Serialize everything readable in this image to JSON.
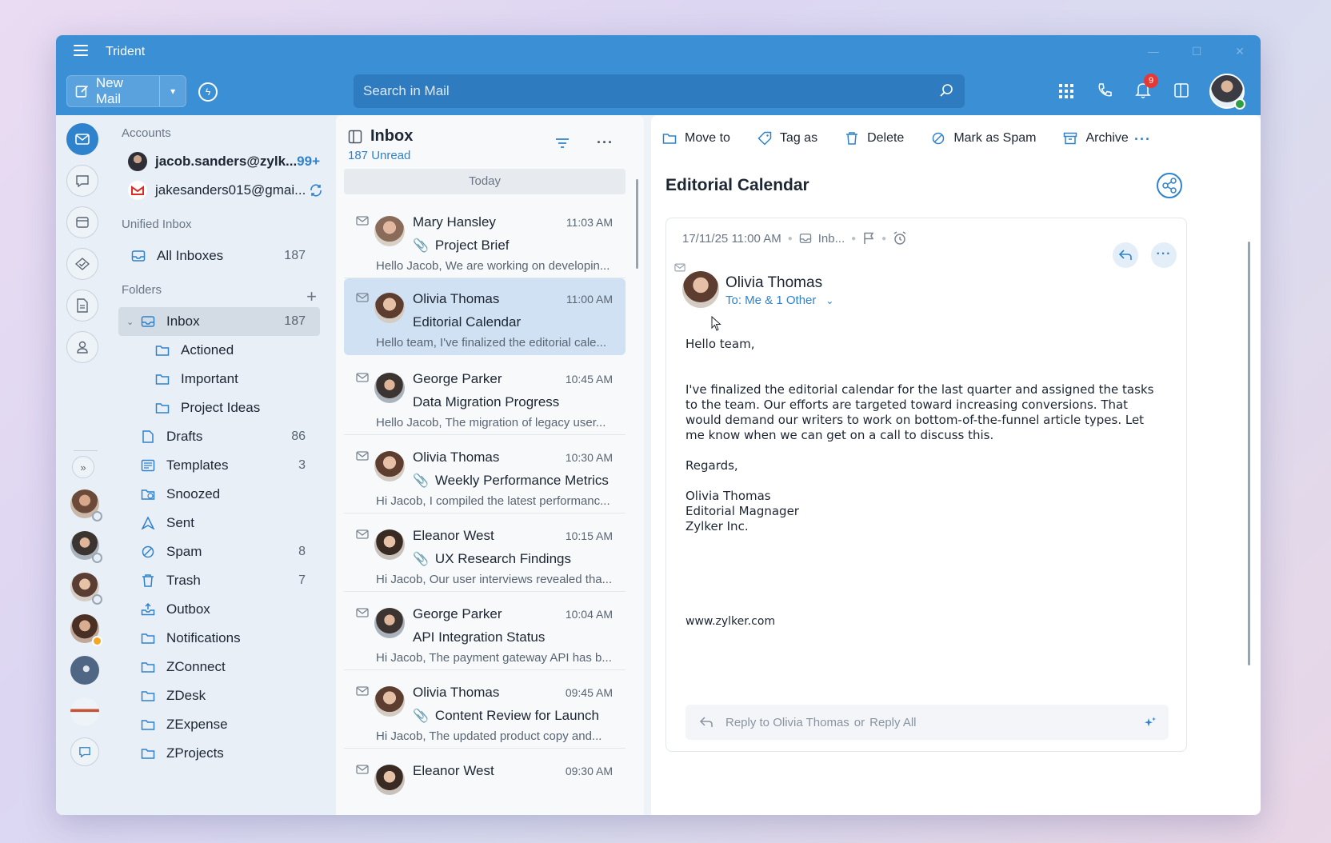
{
  "app": {
    "title": "Trident"
  },
  "header": {
    "new_mail_label": "New Mail",
    "search_placeholder": "Search in Mail",
    "notification_count": "9"
  },
  "rail": {
    "icons": [
      "mail-icon",
      "chat-icon",
      "calendar-icon",
      "tasks-icon",
      "notes-icon",
      "contacts-icon"
    ]
  },
  "folders": {
    "accounts_heading": "Accounts",
    "accounts": [
      {
        "label": "jacob.sanders@zylk...",
        "count": "99+"
      },
      {
        "label": "jakesanders015@gmai..."
      }
    ],
    "unified_heading": "Unified Inbox",
    "unified": [
      {
        "label": "All Inboxes",
        "count": "187"
      }
    ],
    "folders_heading": "Folders",
    "items": [
      {
        "label": "Inbox",
        "count": "187"
      },
      {
        "label": "Actioned"
      },
      {
        "label": "Important"
      },
      {
        "label": "Project Ideas"
      },
      {
        "label": "Drafts",
        "count": "86"
      },
      {
        "label": "Templates",
        "count": "3"
      },
      {
        "label": "Snoozed"
      },
      {
        "label": "Sent"
      },
      {
        "label": "Spam",
        "count": "8"
      },
      {
        "label": "Trash",
        "count": "7"
      },
      {
        "label": "Outbox"
      },
      {
        "label": "Notifications"
      },
      {
        "label": "ZConnect"
      },
      {
        "label": "ZDesk"
      },
      {
        "label": "ZExpense"
      },
      {
        "label": "ZProjects"
      }
    ]
  },
  "list": {
    "title": "Inbox",
    "unread": "187 Unread",
    "group": "Today",
    "messages": [
      {
        "from": "Mary Hansley",
        "time": "11:03 AM",
        "subject": "Project Brief",
        "preview": "Hello Jacob, We are working on developin..."
      },
      {
        "from": "Olivia Thomas",
        "time": "11:00 AM",
        "subject": "Editorial Calendar",
        "preview": "Hello team, I've finalized the editorial cale..."
      },
      {
        "from": "George Parker",
        "time": "10:45 AM",
        "subject": "Data Migration Progress",
        "preview": "Hello Jacob, The migration of legacy user..."
      },
      {
        "from": "Olivia Thomas",
        "time": "10:30 AM",
        "subject": "Weekly Performance Metrics",
        "preview": "Hi Jacob, I compiled the latest performanc..."
      },
      {
        "from": "Eleanor West",
        "time": "10:15 AM",
        "subject": "UX Research Findings",
        "preview": "Hi Jacob, Our user interviews revealed tha..."
      },
      {
        "from": "George Parker",
        "time": "10:04 AM",
        "subject": "API Integration Status",
        "preview": "Hi Jacob, The payment gateway API has b..."
      },
      {
        "from": "Olivia Thomas",
        "time": "09:45 AM",
        "subject": "Content Review for Launch",
        "preview": "Hi Jacob, The updated product copy and..."
      },
      {
        "from": "Eleanor West",
        "time": "09:30 AM"
      }
    ]
  },
  "reader": {
    "toolbar": {
      "move": "Move to",
      "tag": "Tag as",
      "delete": "Delete",
      "spam": "Mark as Spam",
      "archive": "Archive"
    },
    "subject": "Editorial Calendar",
    "date": "17/11/25 11:00 AM",
    "folder": "Inb...",
    "sender": "Olivia Thomas",
    "to": "To: Me & 1 Other",
    "greeting": "Hello team,",
    "paragraph": "I've finalized the editorial calendar for the last quarter and assigned the tasks to the team. Our efforts are targeted toward increasing conversions. That would demand our writers to work on bottom-of-the-funnel article types. Let me know when we can get on a call to discuss this.",
    "regards": "Regards,",
    "sig_name": "Olivia Thomas",
    "sig_title": "Editorial Magnager",
    "sig_company": "Zylker Inc.",
    "website": "www.zylker.com",
    "reply_prefix": "Reply to Olivia Thomas",
    "reply_or": "or",
    "reply_all": "Reply All"
  }
}
